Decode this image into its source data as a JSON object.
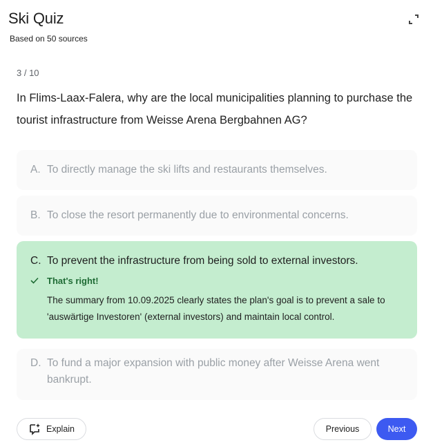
{
  "header": {
    "title": "Ski Quiz",
    "subtitle": "Based on 50 sources",
    "expand_icon": "expand-icon"
  },
  "quiz": {
    "progress": "3 / 10",
    "question": "In Flims-Laax-Falera, why are the local municipalities planning to purchase the tourist infrastructure from Weisse Arena Bergbahnen AG?",
    "options": [
      {
        "letter": "A.",
        "text": "To directly manage the ski lifts and restaurants themselves.",
        "state": "dimmed"
      },
      {
        "letter": "B.",
        "text": "To close the resort permanently due to environmental concerns.",
        "state": "dimmed"
      },
      {
        "letter": "C.",
        "text": "To prevent the infrastructure from being sold to external investors.",
        "state": "correct"
      },
      {
        "letter": "D.",
        "text": "To fund a major expansion with public money after Weisse Arena went bankrupt.",
        "state": "dimmed"
      }
    ],
    "feedback": {
      "label": "That's right!",
      "explanation": "The summary from 10.09.2025 clearly states the plan's goal is to prevent a sale to 'auswärtige Investoren' (external investors) and maintain local control."
    }
  },
  "footer": {
    "explain_label": "Explain",
    "previous_label": "Previous",
    "next_label": "Next"
  },
  "colors": {
    "correct_bg": "#c4edcf",
    "correct_text": "#1e6b34",
    "accent": "#3d5af1",
    "dim_text": "#9aa0a6",
    "option_bg": "#fafafa"
  }
}
